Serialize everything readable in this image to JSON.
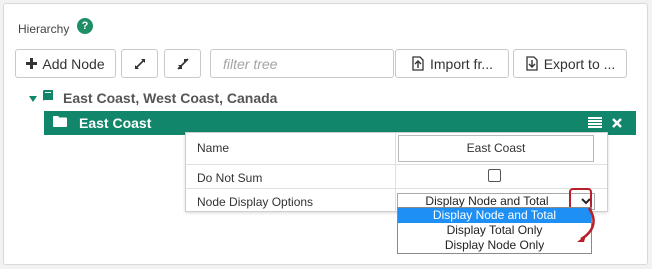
{
  "section": {
    "title": "Hierarchy",
    "help_icon": "?"
  },
  "toolbar": {
    "add_node_label": "Add Node",
    "filter_placeholder": "filter tree",
    "import_label": "Import fr...",
    "export_label": "Export to ..."
  },
  "tree": {
    "root_label": "East Coast, West Coast, Canada",
    "selected_node_label": "East Coast"
  },
  "properties": {
    "name_label": "Name",
    "name_value": "East Coast",
    "do_not_sum_label": "Do Not Sum",
    "do_not_sum_checked": false,
    "display_options_label": "Node Display Options",
    "display_options_value": "Display Node and Total"
  },
  "dropdown": {
    "options": [
      "Display Node and Total",
      "Display Total Only",
      "Display Node Only"
    ],
    "selected_index": 0
  },
  "colors": {
    "accent": "#12866a",
    "selection_blue": "#1e8ff5",
    "annotation_red": "#b81f2a"
  },
  "icons": {
    "add": "plus-icon",
    "expand": "expand-icon",
    "collapse": "collapse-icon",
    "import": "upload-icon",
    "export": "download-icon",
    "tree_toggle": "caret-down-icon",
    "root": "book-icon",
    "node": "folder-icon",
    "menu": "list-icon",
    "close": "close-icon"
  }
}
